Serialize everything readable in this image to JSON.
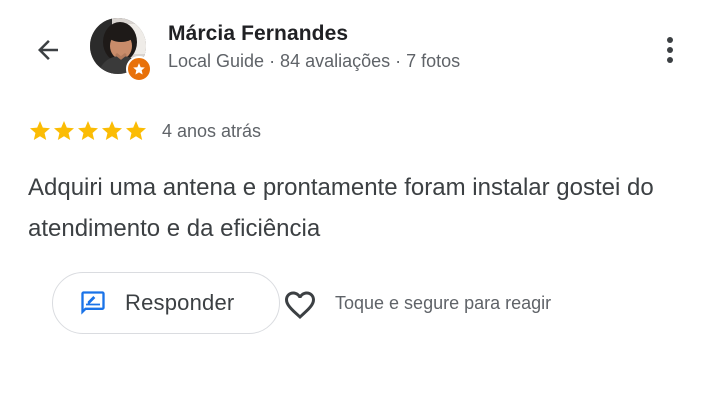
{
  "reviewer": {
    "name": "Márcia Fernandes",
    "meta": "Local Guide · 84 avaliações · 7 fotos",
    "avatar_icon": "profile-photo",
    "badge_icon": "local-guide-star-icon",
    "badge_color": "#e8710a"
  },
  "review": {
    "rating": 5,
    "rating_max": 5,
    "star_color": "#fbbc04",
    "time_ago": "4 anos atrás",
    "text": "Adquiri uma antena e prontamente foram instalar gostei do atendimento e da eficiência"
  },
  "actions": {
    "back_icon": "arrow-back-icon",
    "more_icon": "more-vert-icon",
    "reply_label": "Responder",
    "reply_icon": "rate-review-icon",
    "reply_icon_color": "#1a73e8",
    "react_icon": "heart-outline-icon",
    "react_hint": "Toque e segure para reagir"
  }
}
